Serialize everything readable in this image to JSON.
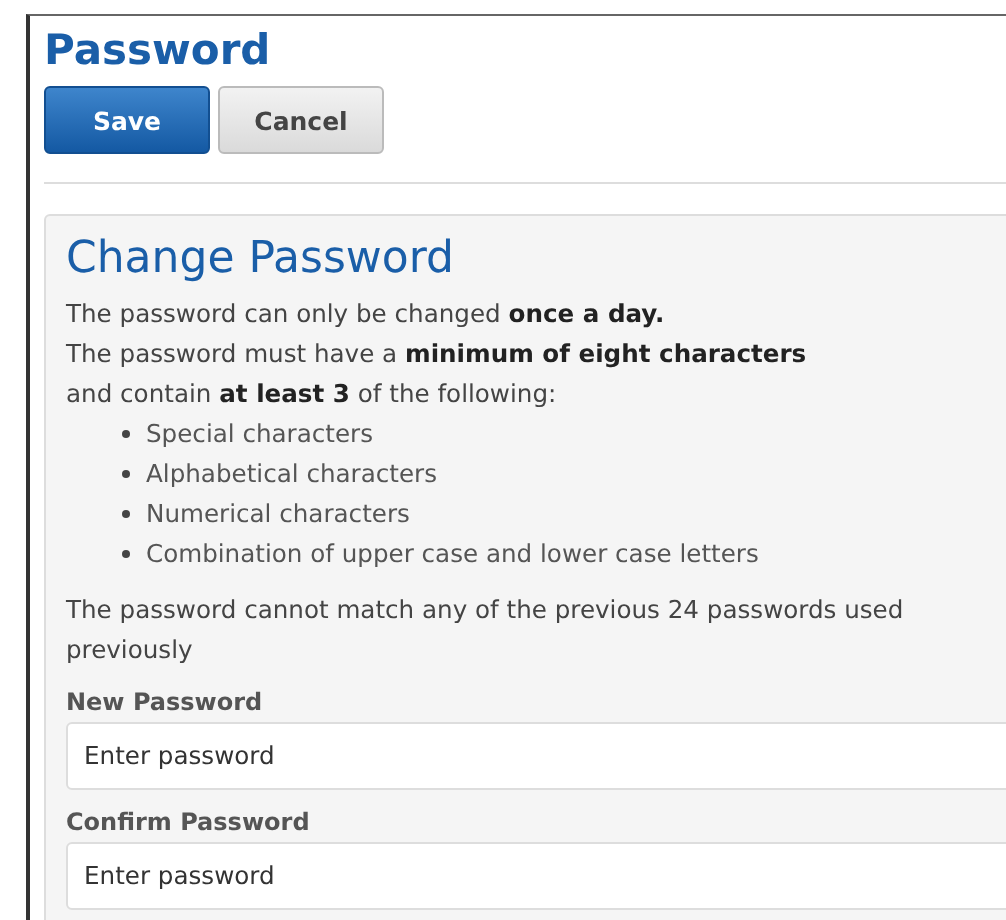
{
  "page_title": "Password",
  "buttons": [
    {
      "label": "Save",
      "kind": "primary"
    },
    {
      "label": "Cancel",
      "kind": "secondary"
    }
  ],
  "panel": {
    "title": "Change Password",
    "lines": [
      "The password can only be changed **once a day.**",
      "The password must have a **minimum of eight characters**",
      "and contain **at least 3** of the following:"
    ],
    "requirements": [
      "Special characters",
      "Alphabetical characters",
      "Numerical characters",
      "Combination of upper case and lower case letters"
    ],
    "note": "The password cannot match any of the previous 24 passwords used previously",
    "fields": [
      {
        "label": "New Password",
        "placeholder": "Enter password"
      },
      {
        "label": "Confirm Password",
        "placeholder": "Enter password"
      }
    ]
  }
}
